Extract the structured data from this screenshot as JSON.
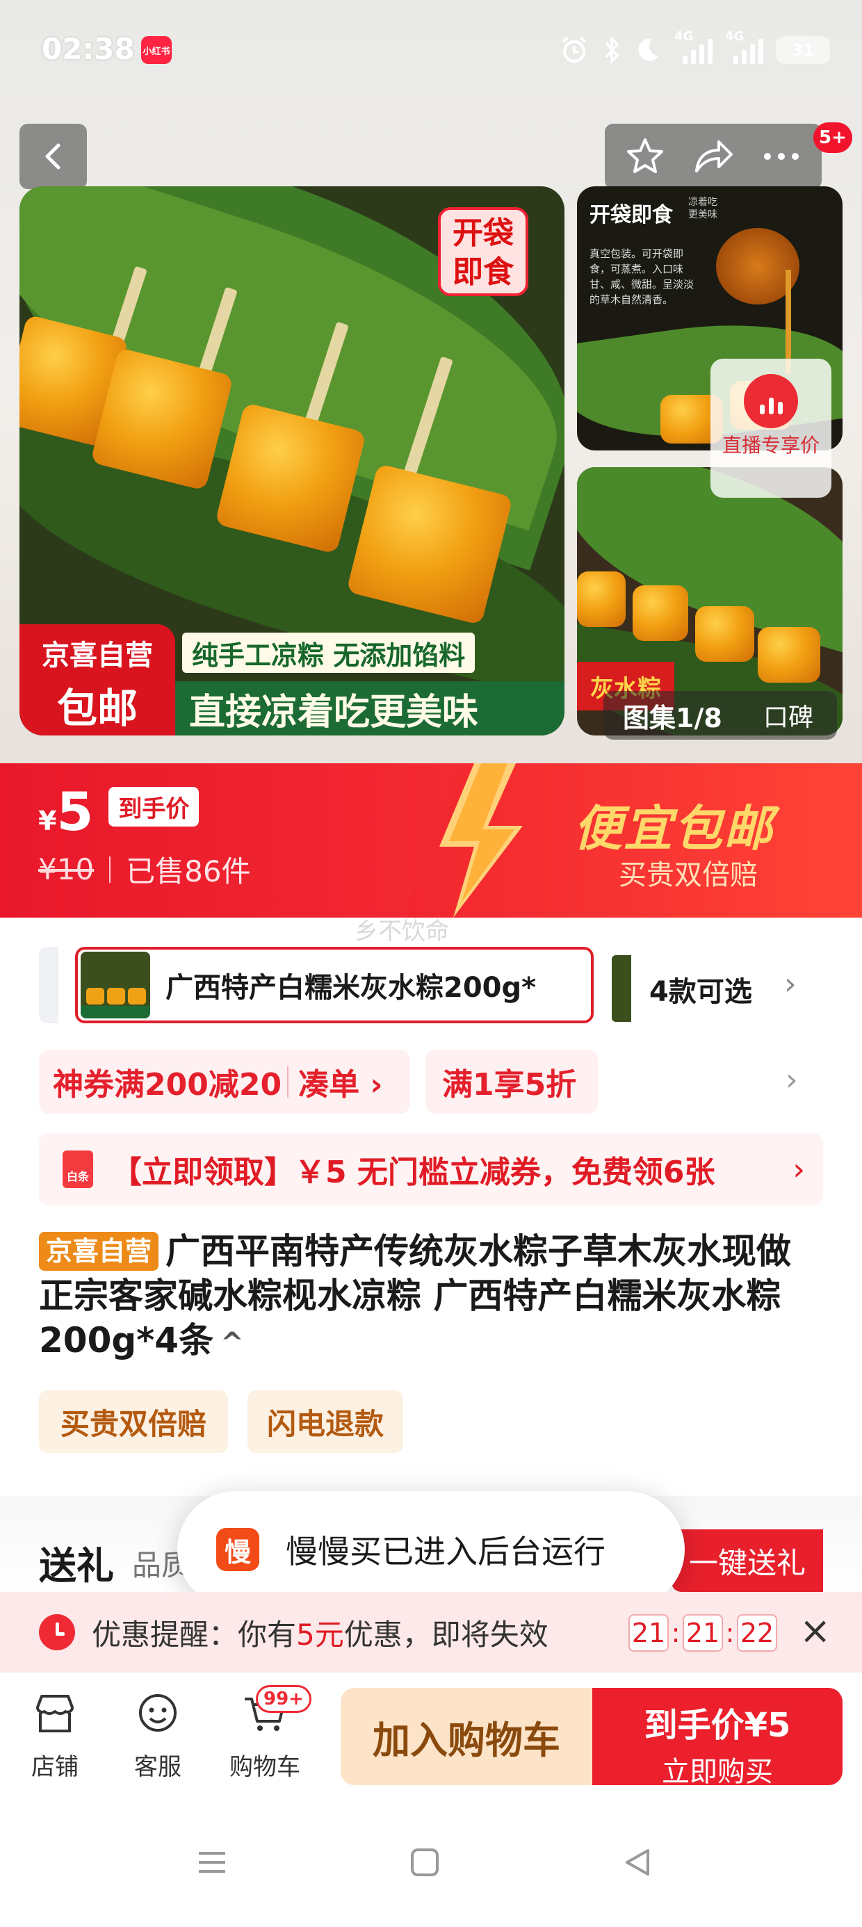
{
  "status_bar": {
    "time": "02:38",
    "app_badge": "小红书",
    "net1": "4G",
    "net2": "4G",
    "battery": "31",
    "icons": [
      "alarm-icon",
      "bluetooth-icon",
      "moon-icon",
      "signal-icon",
      "signal-icon",
      "battery-icon"
    ]
  },
  "header": {
    "notification_count": "5+",
    "actions": [
      "back-icon",
      "star-icon",
      "share-icon",
      "more-icon"
    ]
  },
  "gallery": {
    "main_sticker": "开袋即食",
    "ship_badge_line1": "京喜自营",
    "ship_badge_line2": "包邮",
    "caption_top": "纯手工凉粽 无添加馅料",
    "caption_bottom": "直接凉着吃更美味",
    "thumb1_title": "开袋即食",
    "thumb1_sub": "凉着吃 更美味",
    "thumb1_text": "真空包装。可开袋即食，可蒸煮。入口味甘、咸、微甜。呈淡淡的草木自然清香。",
    "thumb2_mark": "灰水粽",
    "live_label": "直播专享价",
    "counter": "图集1/8",
    "counter_word": "口碑"
  },
  "price_banner": {
    "currency": "¥",
    "price": "5",
    "price_tag": "到手价",
    "original_price": "¥10",
    "sold": "已售86件",
    "promo_title": "便宜包邮",
    "promo_sub": "买贵双倍赔",
    "watermark": "乡不饮命"
  },
  "variants": {
    "selected_label": "广西特产白糯米灰水粽200g*",
    "count_label": "4款可选"
  },
  "coupons": {
    "pill1_main": "神券满200减20",
    "pill1_action": "凑单 ›",
    "pill2": "满1享5折",
    "free_coupon_icon": "白条",
    "free_coupon_text": "【立即领取】￥5 无门槛立减券，免费领6张"
  },
  "product": {
    "tag": "京喜自营",
    "title": "广西平南特产传统灰水粽子草木灰水现做正宗客家碱水粽枧水凉粽 广西特产白糯米灰水粽200g*4条",
    "guarantees": [
      "买贵双倍赔",
      "闪电退款"
    ]
  },
  "gift": {
    "title": "送礼",
    "subtitle": "品质",
    "button": "一键送礼"
  },
  "toast": {
    "icon_char": "慢",
    "text": "慢慢买已进入后台运行"
  },
  "reminder": {
    "prefix": "优惠提醒：你有",
    "amount": "5元",
    "suffix": "优惠，即将失效",
    "hours": "21",
    "minutes": "21",
    "seconds": "22"
  },
  "bottom_bar": {
    "store": "店铺",
    "service": "客服",
    "cart": "购物车",
    "cart_badge": "99+",
    "add_to_cart": "加入购物车",
    "buy_price": "到手价¥5",
    "buy_label": "立即购买"
  },
  "colors": {
    "brand_red": "#ec1f2d",
    "promo_gold": "#ffd86a",
    "self_operated_orange": "#ee8a18"
  }
}
